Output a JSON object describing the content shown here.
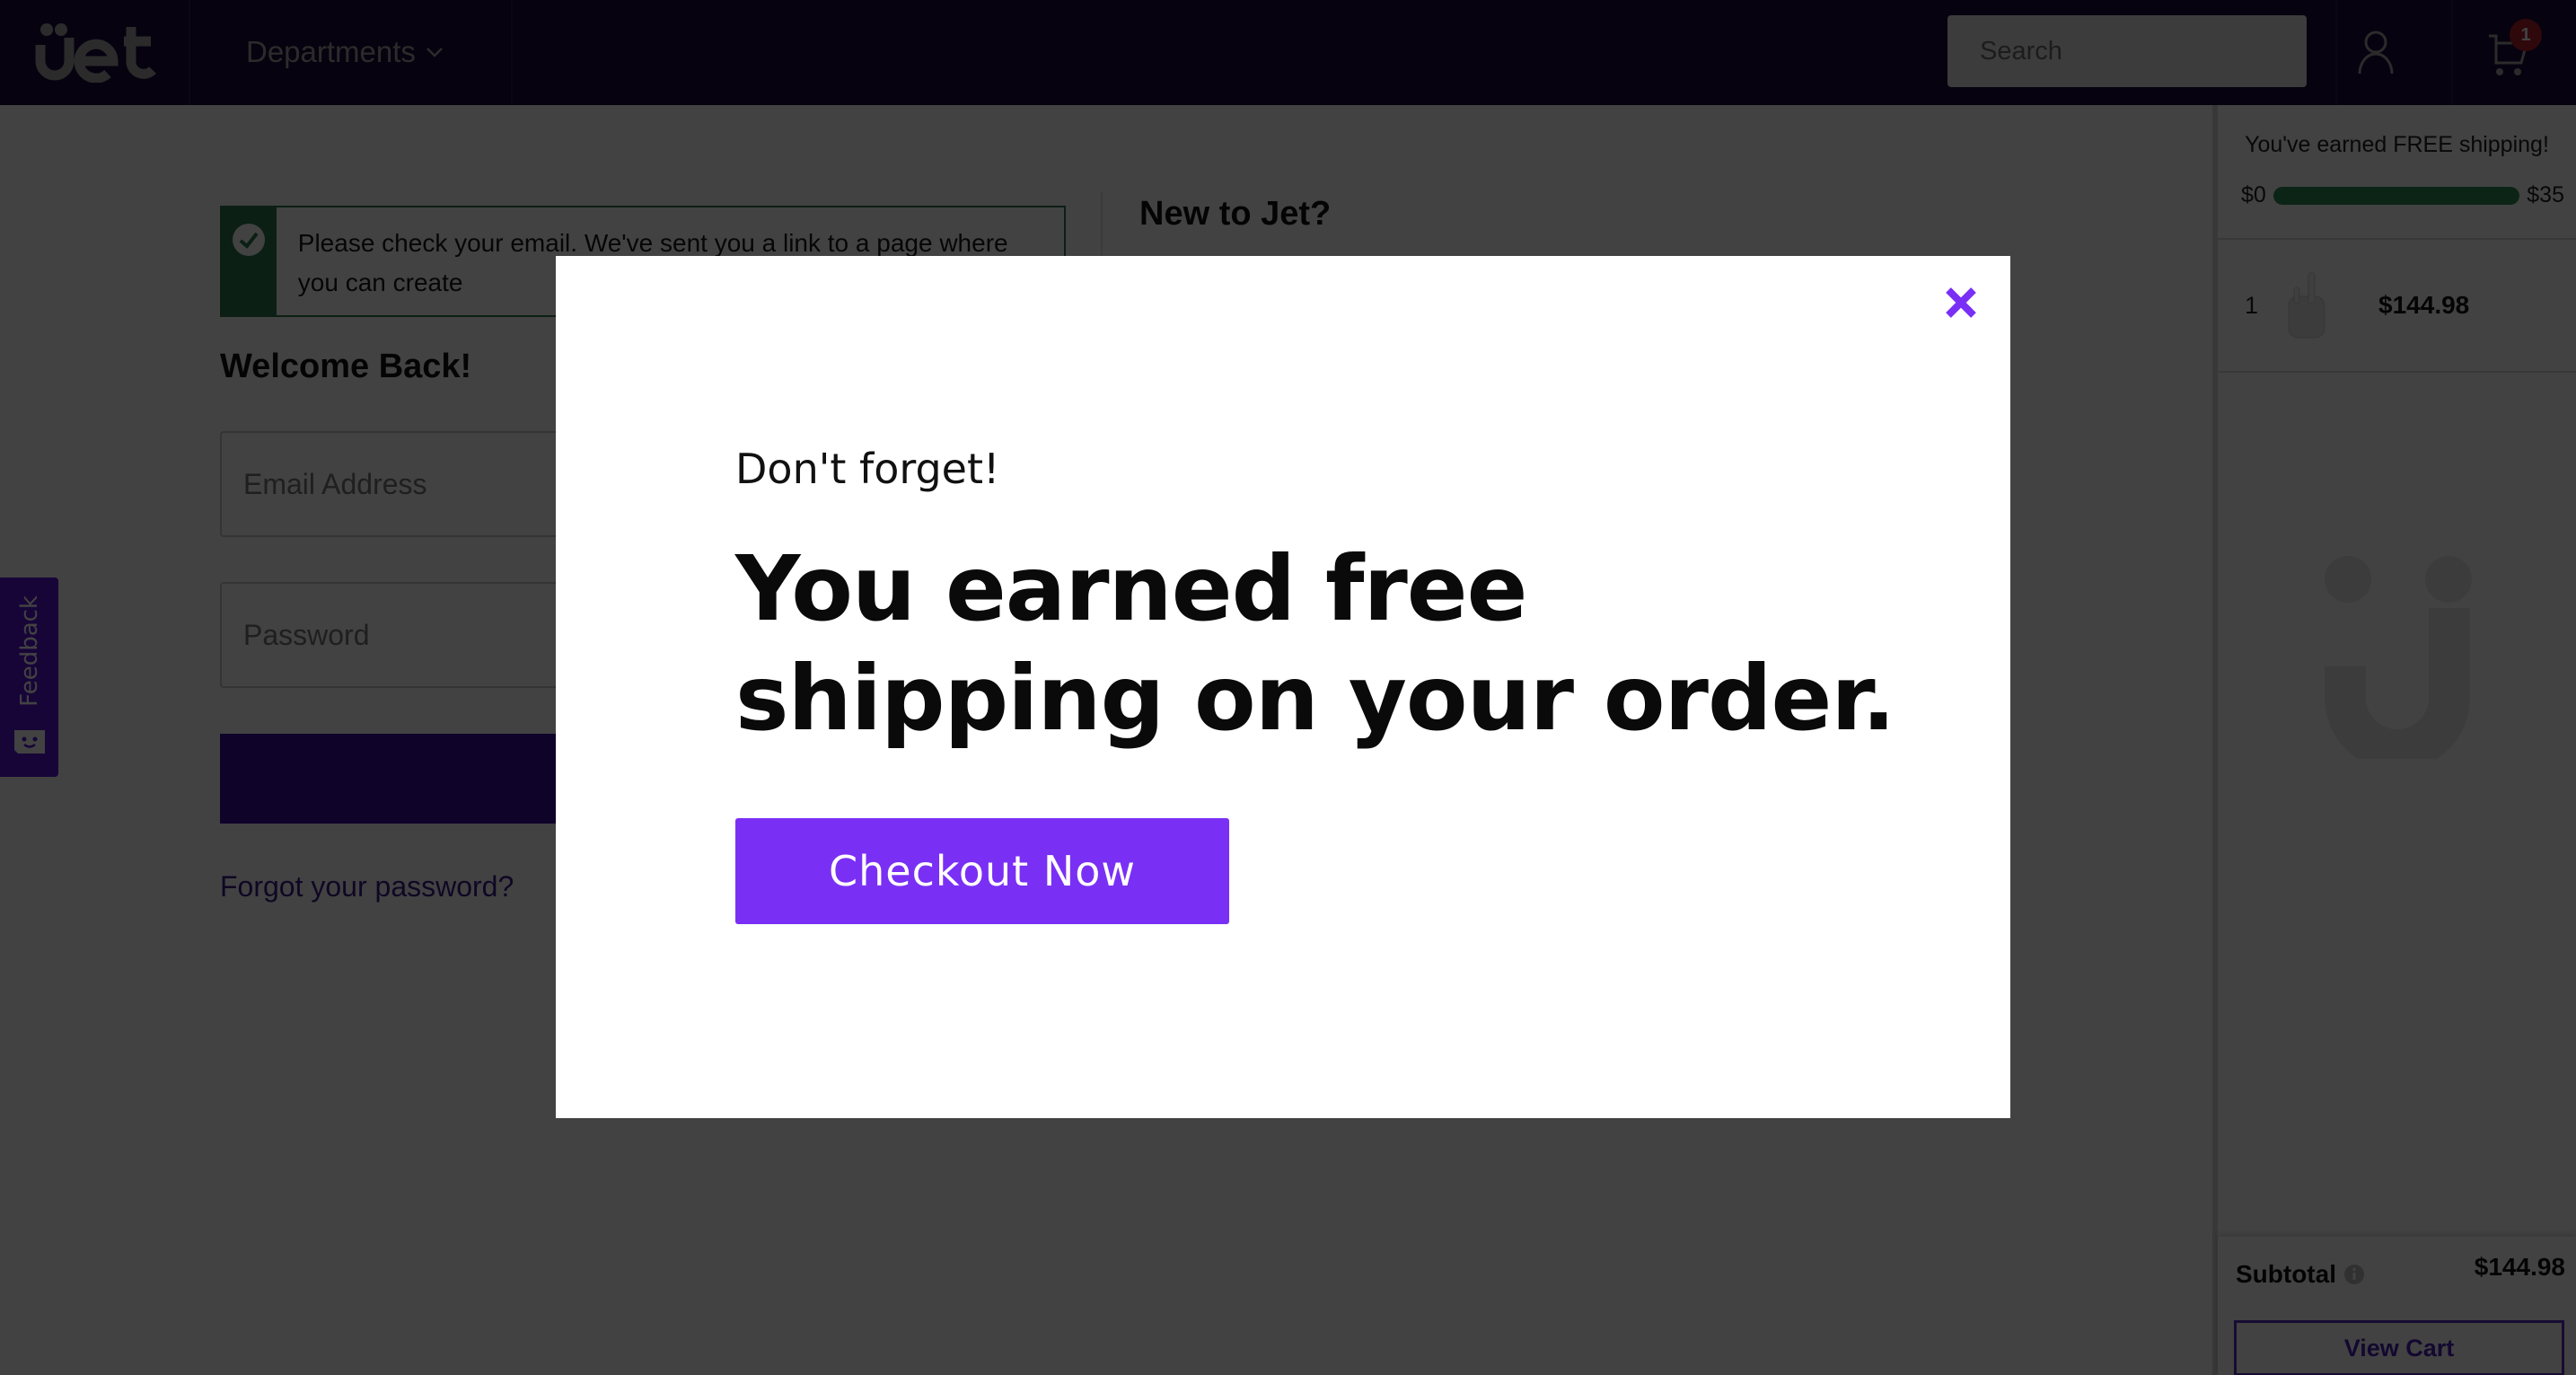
{
  "header": {
    "logo_text": "jet",
    "departments_label": "Departments",
    "search": {
      "placeholder": "Search",
      "value": ""
    },
    "cart_count": "1"
  },
  "signin": {
    "alert_message": "Please check your email. We've sent you a link to a page where you can create",
    "title": "Welcome Back!",
    "email_placeholder": "Email Address",
    "password_placeholder": "Password",
    "forgot_link": "Forgot your password?",
    "new_to_jet_title": "New to Jet?"
  },
  "feedback": {
    "label": "Feedback"
  },
  "cart_panel": {
    "shipping_message": "You've earned FREE shipping!",
    "progress_min_label": "$0",
    "progress_max_label": "$35",
    "progress_fraction": 1.0,
    "items": [
      {
        "quantity": "1",
        "product_icon": "airpods-image",
        "price": "$144.98"
      }
    ],
    "subtotal_label": "Subtotal",
    "subtotal_value": "$144.98",
    "view_cart_label": "View Cart"
  },
  "modal": {
    "eyebrow": "Don't forget!",
    "headline": "You earned free shipping on your order.",
    "cta_label": "Checkout Now",
    "close_icon": "close-icon"
  },
  "colors": {
    "header_bg": "#1a0b3a",
    "accent_purple": "#7a2ff5",
    "success_green": "#2d7a4e",
    "badge_red": "#b41f2c"
  }
}
